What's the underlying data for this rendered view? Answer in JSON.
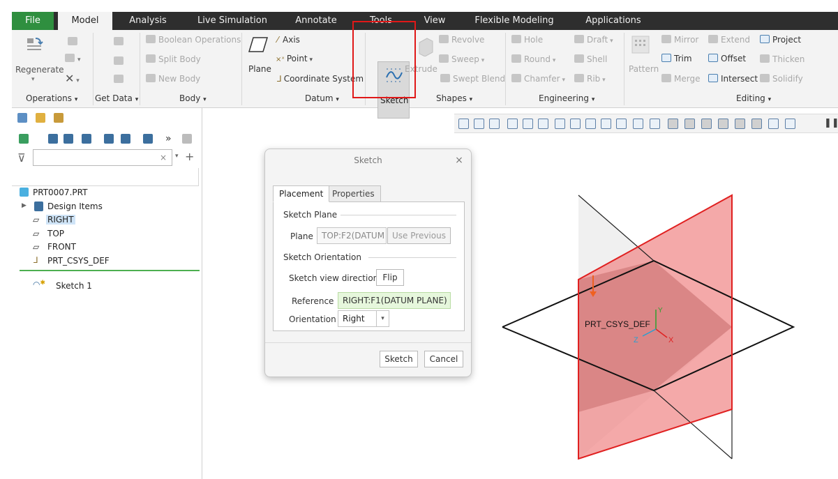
{
  "menu": {
    "tabs": [
      "File",
      "Model",
      "Analysis",
      "Live Simulation",
      "Annotate",
      "Tools",
      "View",
      "Flexible Modeling",
      "Applications"
    ],
    "active": "Model"
  },
  "ribbon": {
    "regenerate": "Regenerate",
    "get_data_group": "Get Data",
    "body": {
      "boolean": "Boolean Operations",
      "split": "Split Body",
      "new": "New Body"
    },
    "datum": {
      "plane": "Plane",
      "axis": "Axis",
      "point": "Point",
      "csys": "Coordinate System"
    },
    "sketch": "Sketch",
    "extrude": "Extrude",
    "shapes": {
      "revolve": "Revolve",
      "sweep": "Sweep",
      "swept_blend": "Swept Blend"
    },
    "engineering": {
      "hole": "Hole",
      "draft": "Draft",
      "round": "Round",
      "shell": "Shell",
      "chamfer": "Chamfer",
      "rib": "Rib"
    },
    "editing": {
      "pattern": "Pattern",
      "mirror": "Mirror",
      "extend": "Extend",
      "project": "Project",
      "trim": "Trim",
      "offset": "Offset",
      "thicken": "Thicken",
      "merge": "Merge",
      "intersect": "Intersect",
      "solidify": "Solidify"
    },
    "groups": {
      "operations": "Operations",
      "get_data": "Get Data",
      "body": "Body",
      "datum": "Datum",
      "shapes": "Shapes",
      "engineering": "Engineering",
      "editing": "Editing"
    }
  },
  "tree": {
    "filter_value": "",
    "items": [
      "PRT0007.PRT",
      "Design Items",
      "RIGHT",
      "TOP",
      "FRONT",
      "PRT_CSYS_DEF",
      "Sketch 1"
    ],
    "selected": "RIGHT"
  },
  "dialog": {
    "title": "Sketch",
    "tabs": [
      "Placement",
      "Properties"
    ],
    "sketch_plane_label": "Sketch Plane",
    "plane_label": "Plane",
    "plane_value": "TOP:F2(DATUM",
    "use_previous": "Use Previous",
    "orientation_section": "Sketch Orientation",
    "view_direction_label": "Sketch view direction",
    "flip": "Flip",
    "reference_label": "Reference",
    "reference_value": "RIGHT:F1(DATUM PLANE)",
    "orientation_label": "Orientation",
    "orientation_value": "Right",
    "sketch_button": "Sketch",
    "cancel_button": "Cancel"
  },
  "viewport": {
    "csys_label": "PRT_CSYS_DEF",
    "axis_x": "X",
    "axis_y": "Y",
    "axis_z": "Z"
  },
  "colors": {
    "file_tab": "#2f8f3f",
    "highlight": "#e01818",
    "datum_red": "#e02020",
    "plane_fill_red": "#f08c8c",
    "plane_fill_gray": "#e6e6e6"
  }
}
